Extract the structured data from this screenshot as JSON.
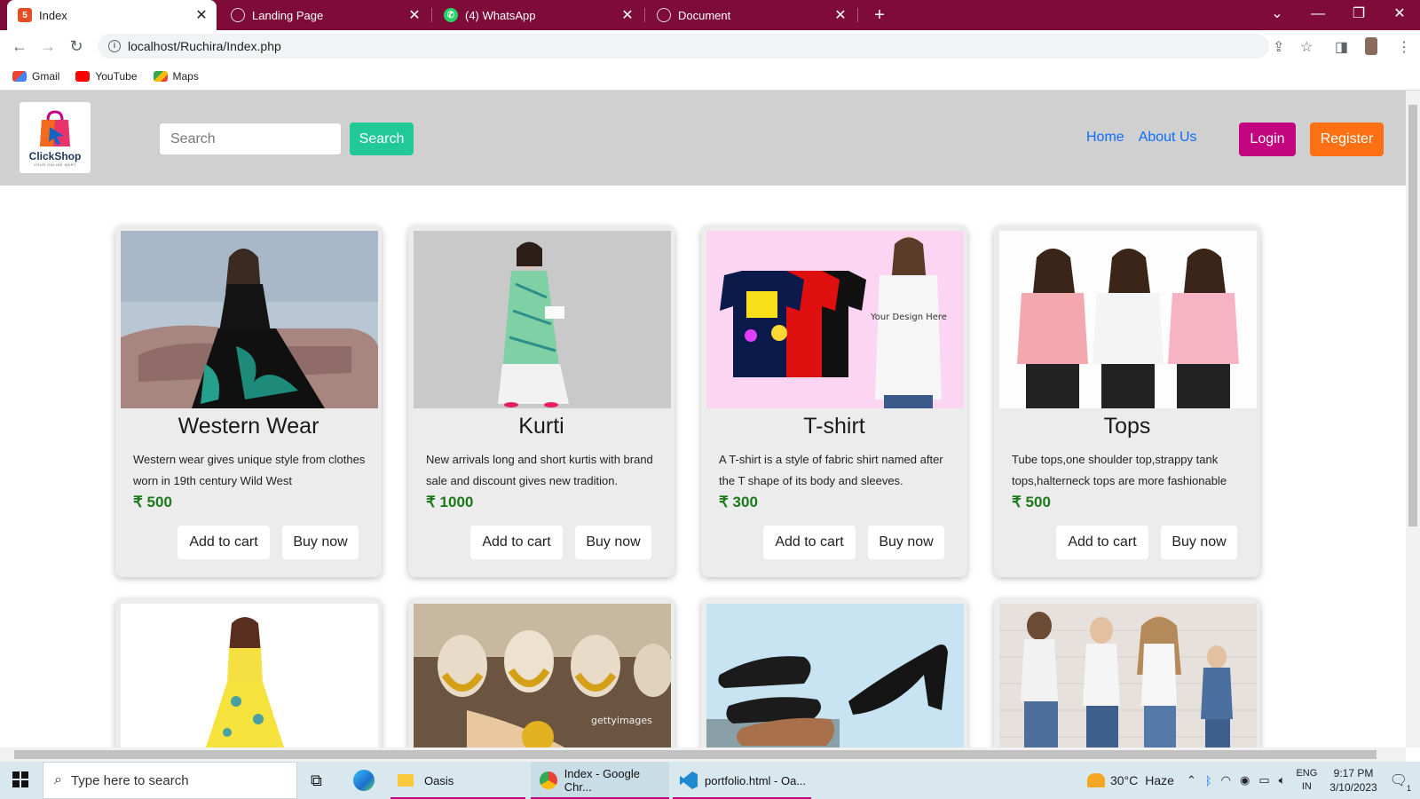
{
  "browser": {
    "tabs": [
      {
        "title": "Index",
        "active": true
      },
      {
        "title": "Landing Page",
        "active": false
      },
      {
        "title": "(4) WhatsApp",
        "active": false
      },
      {
        "title": "Document",
        "active": false
      }
    ],
    "url": "localhost/Ruchira/Index.php",
    "bookmarks": [
      "Gmail",
      "YouTube",
      "Maps"
    ]
  },
  "header": {
    "logo_text": "ClickShop",
    "logo_tagline": "YOUR ONLINE MART",
    "search_placeholder": "Search",
    "search_button": "Search",
    "nav": [
      "Home",
      "About Us"
    ],
    "login": "Login",
    "register": "Register"
  },
  "products": [
    {
      "name": "Western Wear",
      "desc": "Western wear gives unique style from clothes worn in 19th century Wild West",
      "price": "₹ 500",
      "add_to_cart": "Add to cart",
      "buy_now": "Buy now"
    },
    {
      "name": "Kurti",
      "desc": "New arrivals long and short kurtis with brand sale and discount gives new tradition.",
      "price": "₹ 1000",
      "add_to_cart": "Add to cart",
      "buy_now": "Buy now"
    },
    {
      "name": "T-shirt",
      "desc": "A T-shirt is a style of fabric shirt named after the T shape of its body and sleeves.",
      "price": "₹ 300",
      "add_to_cart": "Add to cart",
      "buy_now": "Buy now"
    },
    {
      "name": "Tops",
      "desc": "Tube tops,one shoulder top,strappy tank tops,halterneck tops are more fashionable",
      "price": "₹ 500",
      "add_to_cart": "Add to cart",
      "buy_now": "Buy now"
    }
  ],
  "tshirt_print": "Your Design Here",
  "jewelry_watermark": "gettyimages",
  "taskbar": {
    "search_placeholder": "Type here to search",
    "apps": [
      "Oasis",
      "Index - Google Chr...",
      "portfolio.html - Oa..."
    ],
    "weather_temp": "30°C",
    "weather_desc": "Haze",
    "lang": "ENG",
    "region": "IN",
    "time": "9:17 PM",
    "date": "3/10/2023",
    "notifications": "1"
  },
  "colors": {
    "tab_bar": "#7e0b38",
    "search_btn": "#20c997",
    "login": "#c0057f",
    "register": "#fd7014",
    "price": "#1a7a1a"
  }
}
